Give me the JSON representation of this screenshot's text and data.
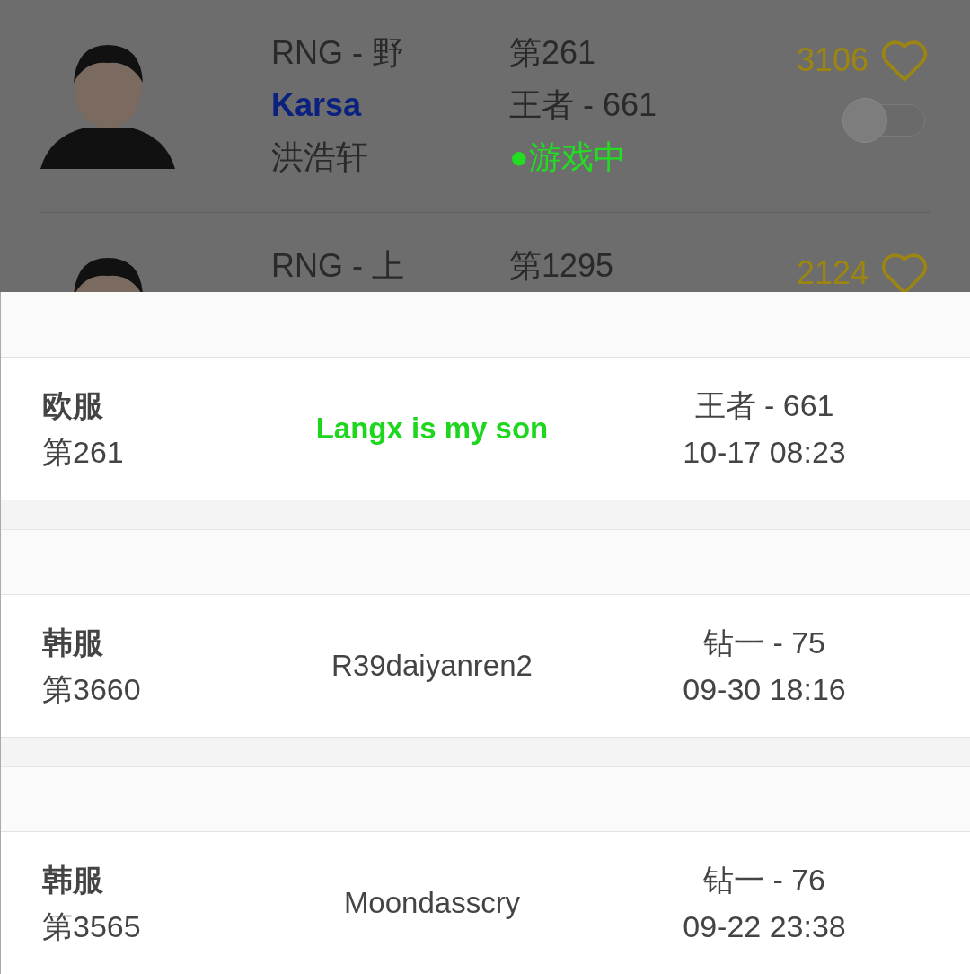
{
  "players": [
    {
      "team_role": "RNG - 野",
      "name": "Karsa",
      "real_name": "洪浩轩",
      "rank": "第261",
      "tier": "王者 - 661",
      "status": "●游戏中",
      "likes": "3106",
      "liked": false,
      "following": false
    },
    {
      "team_role": "RNG - 上",
      "rank": "第1295",
      "likes": "2124",
      "liked": false
    }
  ],
  "accounts": [
    {
      "server": "欧服",
      "rank": "第261",
      "name": "Langx is my son",
      "highlighted": true,
      "tier": "王者 - 661",
      "time": "10-17 08:23"
    },
    {
      "server": "韩服",
      "rank": "第3660",
      "name": "R39daiyanren2",
      "highlighted": false,
      "tier": "钻一 - 75",
      "time": "09-30 18:16"
    },
    {
      "server": "韩服",
      "rank": "第3565",
      "name": "Moondasscry",
      "highlighted": false,
      "tier": "钻一 - 76",
      "time": "09-22 23:38"
    }
  ]
}
